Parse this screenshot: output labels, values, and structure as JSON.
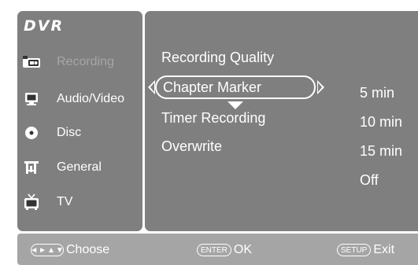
{
  "app_title": "DVR",
  "sidebar": {
    "items": [
      {
        "label": "Recording",
        "icon": "video-camera-icon"
      },
      {
        "label": "Audio/Video",
        "icon": "monitor-icon"
      },
      {
        "label": "Disc",
        "icon": "disc-icon"
      },
      {
        "label": "General",
        "icon": "tools-icon"
      },
      {
        "label": "TV",
        "icon": "tv-icon"
      }
    ]
  },
  "main": {
    "options": [
      {
        "label": "Recording Quality"
      },
      {
        "label": "Chapter Marker"
      },
      {
        "label": "Timer Recording"
      },
      {
        "label": "Overwrite"
      }
    ],
    "selected_option": "Chapter Marker",
    "values": [
      "5 min",
      "10 min",
      "15 min",
      "Off"
    ]
  },
  "hints": {
    "choose": {
      "key": "◄►▲▼",
      "label": "Choose"
    },
    "ok": {
      "key": "ENTER",
      "label": "OK"
    },
    "exit": {
      "key": "SETUP",
      "label": "Exit"
    }
  },
  "colors": {
    "panel": "#7f7f7f",
    "bottom_bar": "#a5a5a5",
    "dim_text": "#a6a6a6",
    "text": "#ffffff"
  }
}
